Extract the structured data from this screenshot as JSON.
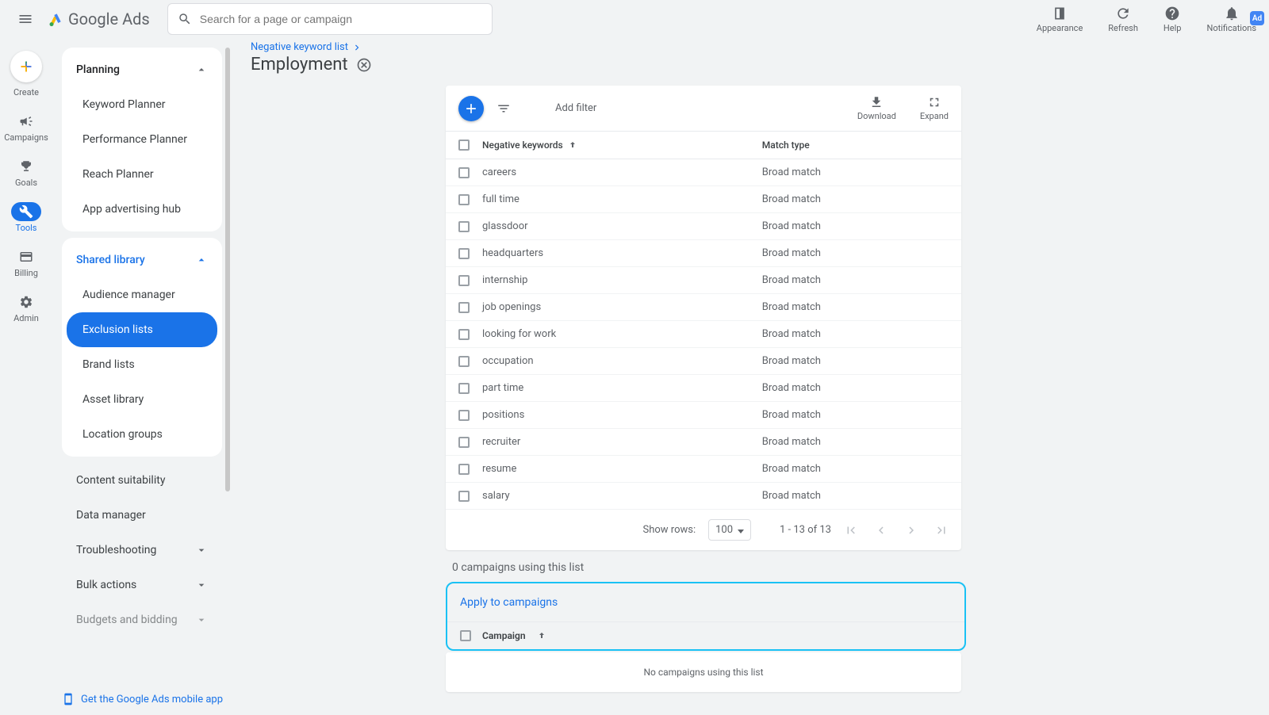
{
  "header": {
    "brand": "Google Ads",
    "search_placeholder": "Search for a page or campaign",
    "appearance": "Appearance",
    "refresh": "Refresh",
    "help": "Help",
    "notifications": "Notifications",
    "ad_badge": "Ad"
  },
  "rail": {
    "create": "Create",
    "campaigns": "Campaigns",
    "goals": "Goals",
    "tools": "Tools",
    "billing": "Billing",
    "admin": "Admin"
  },
  "sidebar": {
    "planning": {
      "label": "Planning",
      "items": [
        "Keyword Planner",
        "Performance Planner",
        "Reach Planner",
        "App advertising hub"
      ]
    },
    "shared_library": {
      "label": "Shared library",
      "items": [
        "Audience manager",
        "Exclusion lists",
        "Brand lists",
        "Asset library",
        "Location groups"
      ]
    },
    "content_suitability": "Content suitability",
    "data_manager": "Data manager",
    "troubleshooting": "Troubleshooting",
    "bulk_actions": "Bulk actions",
    "budgets": "Budgets and bidding",
    "mobile_app": "Get the Google Ads mobile app"
  },
  "breadcrumb": "Negative keyword list",
  "page_title": "Employment",
  "toolbar": {
    "add_filter": "Add filter",
    "download": "Download",
    "expand": "Expand"
  },
  "table": {
    "header_kw": "Negative keywords",
    "header_match": "Match type",
    "rows": [
      {
        "kw": "careers",
        "mt": "Broad match"
      },
      {
        "kw": "full time",
        "mt": "Broad match"
      },
      {
        "kw": "glassdoor",
        "mt": "Broad match"
      },
      {
        "kw": "headquarters",
        "mt": "Broad match"
      },
      {
        "kw": "internship",
        "mt": "Broad match"
      },
      {
        "kw": "job openings",
        "mt": "Broad match"
      },
      {
        "kw": "looking for work",
        "mt": "Broad match"
      },
      {
        "kw": "occupation",
        "mt": "Broad match"
      },
      {
        "kw": "part time",
        "mt": "Broad match"
      },
      {
        "kw": "positions",
        "mt": "Broad match"
      },
      {
        "kw": "recruiter",
        "mt": "Broad match"
      },
      {
        "kw": "resume",
        "mt": "Broad match"
      },
      {
        "kw": "salary",
        "mt": "Broad match"
      }
    ],
    "show_rows": "Show rows:",
    "rows_value": "100",
    "page_info": "1 - 13 of 13"
  },
  "campaigns_using": "0 campaigns using this list",
  "apply": {
    "label": "Apply to campaigns",
    "col": "Campaign"
  },
  "no_campaigns": "No campaigns using this list"
}
